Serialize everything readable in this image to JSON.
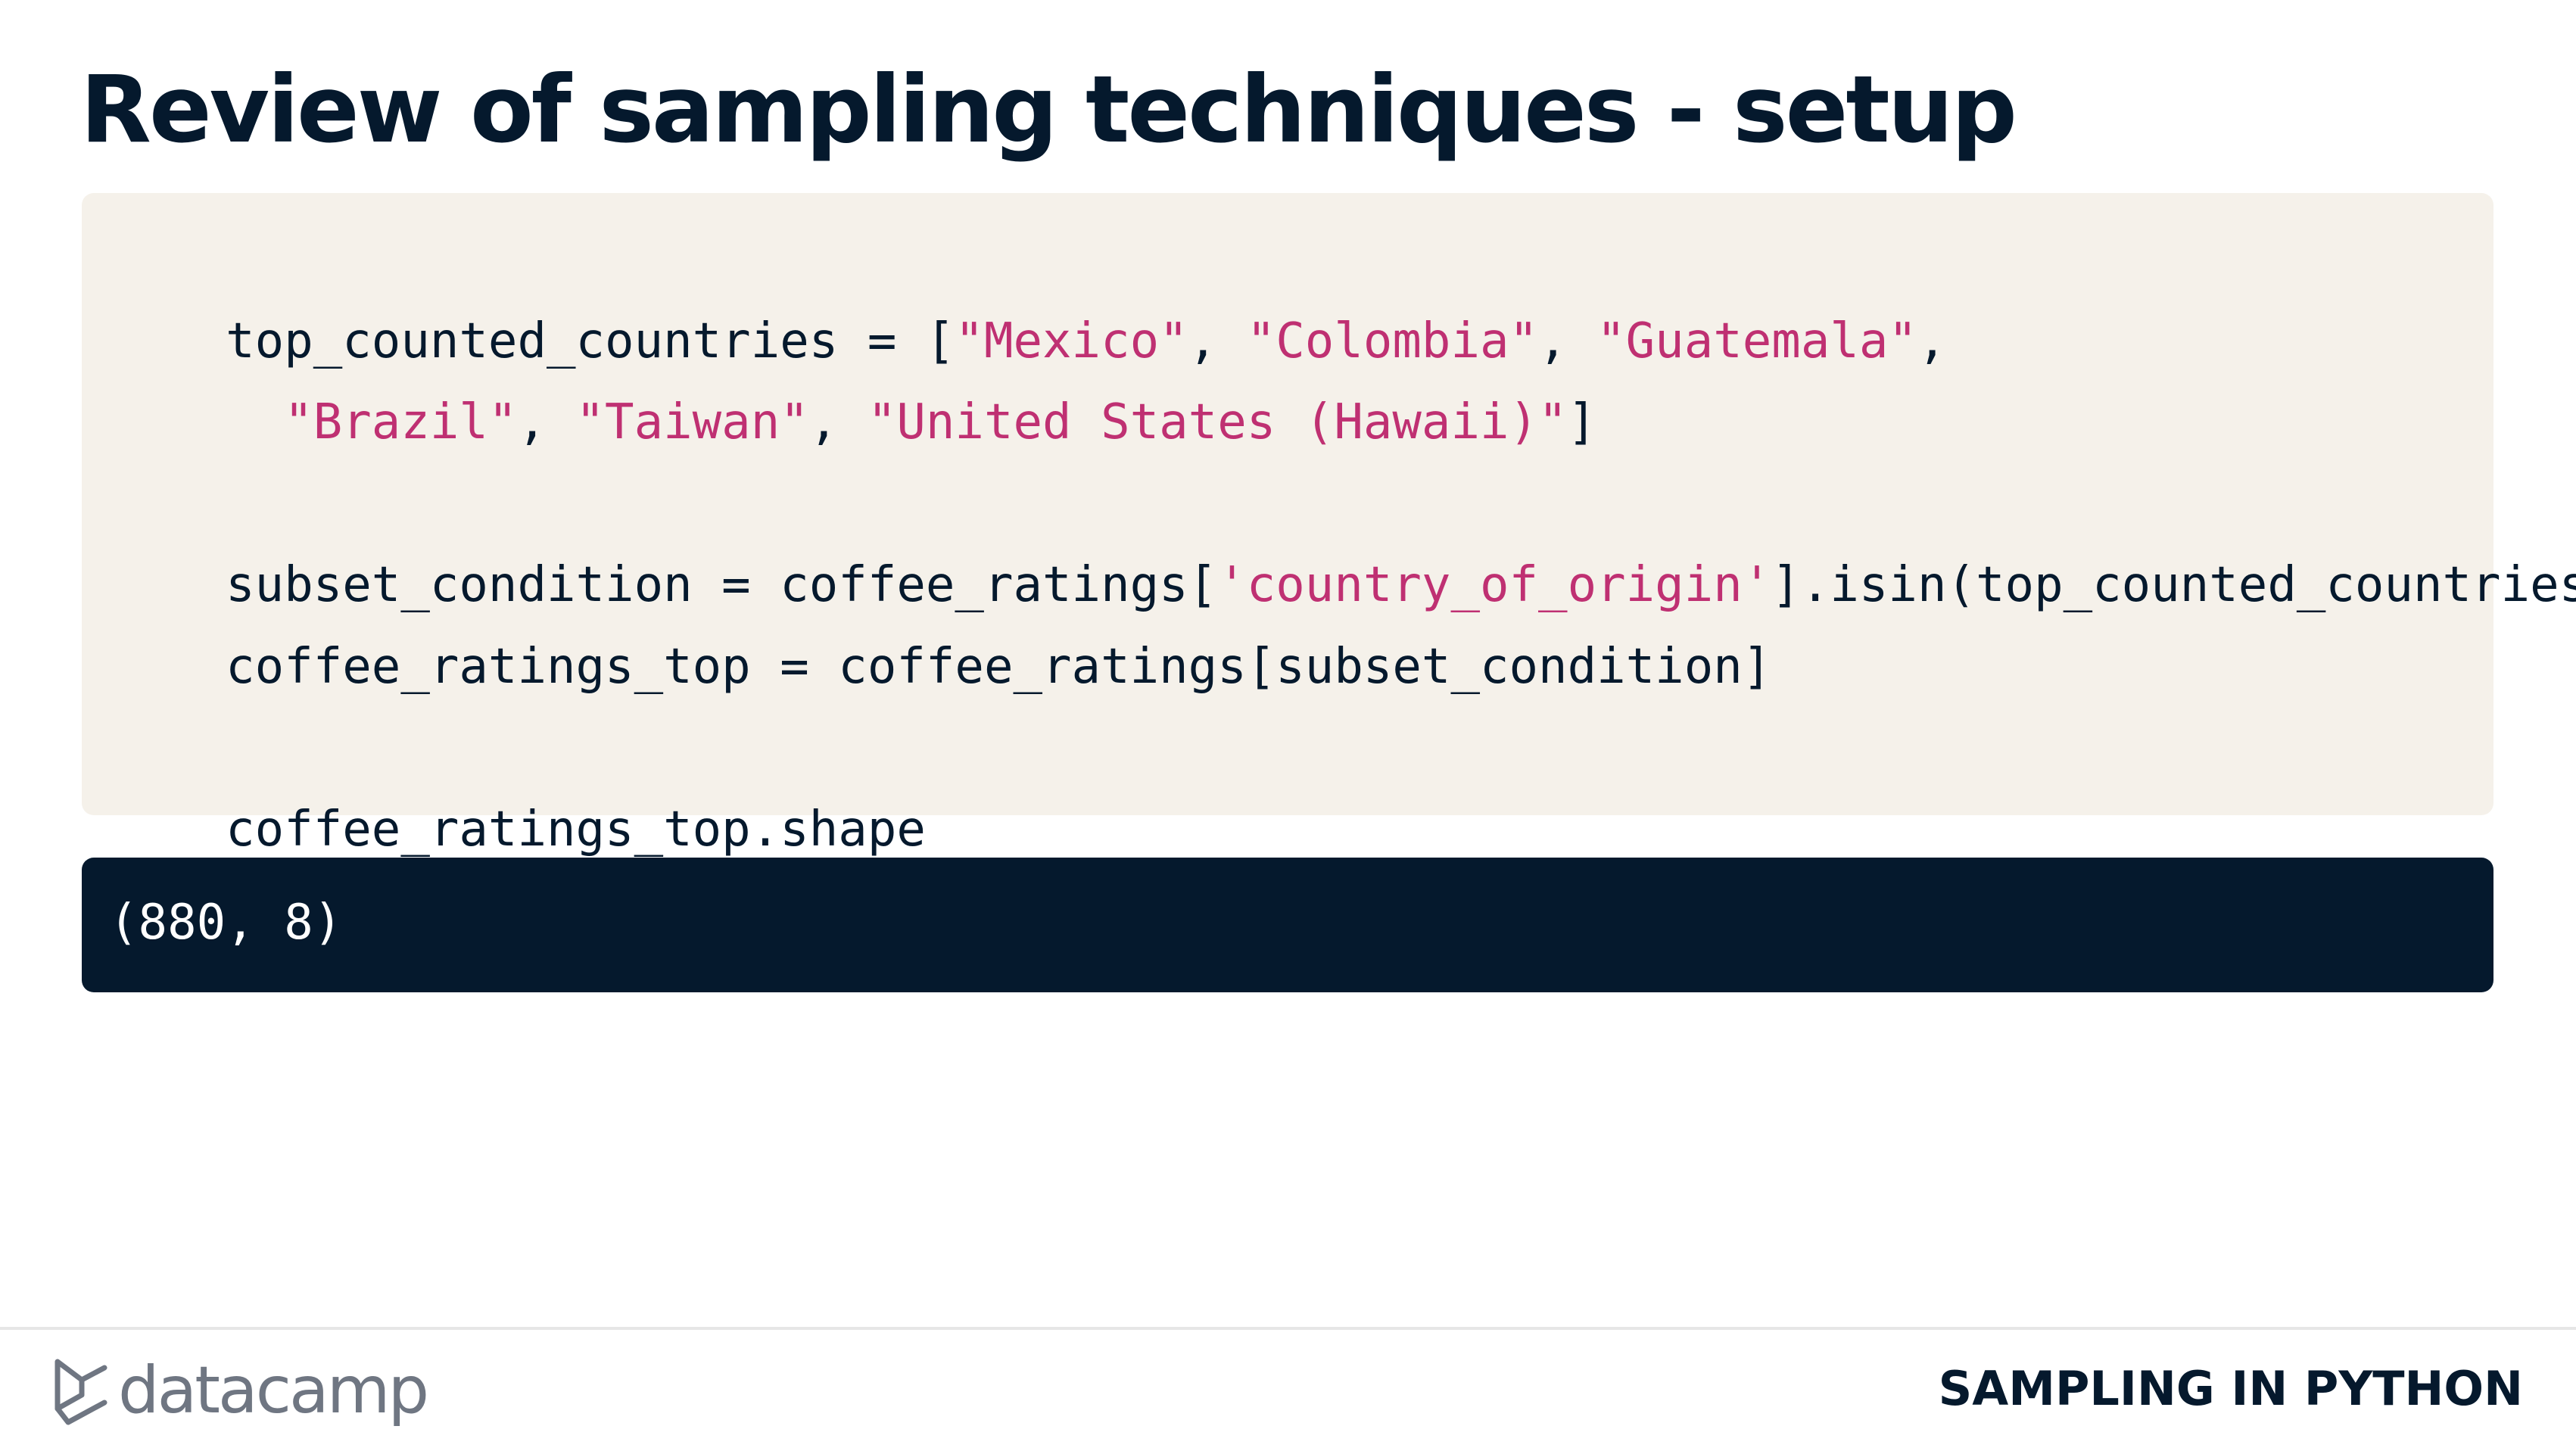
{
  "slide": {
    "title": "Review of sampling techniques - setup"
  },
  "code": {
    "lines": [
      [
        {
          "text": "top_counted_countries = [",
          "kind": "plain"
        },
        {
          "text": "\"Mexico\"",
          "kind": "string"
        },
        {
          "text": ", ",
          "kind": "plain"
        },
        {
          "text": "\"Colombia\"",
          "kind": "string"
        },
        {
          "text": ", ",
          "kind": "plain"
        },
        {
          "text": "\"Guatemala\"",
          "kind": "string"
        },
        {
          "text": ",",
          "kind": "plain"
        }
      ],
      [
        {
          "text": "  ",
          "kind": "plain"
        },
        {
          "text": "\"Brazil\"",
          "kind": "string"
        },
        {
          "text": ", ",
          "kind": "plain"
        },
        {
          "text": "\"Taiwan\"",
          "kind": "string"
        },
        {
          "text": ", ",
          "kind": "plain"
        },
        {
          "text": "\"United States (Hawaii)\"",
          "kind": "string"
        },
        {
          "text": "]",
          "kind": "plain"
        }
      ],
      [],
      [
        {
          "text": "subset_condition = coffee_ratings[",
          "kind": "plain"
        },
        {
          "text": "'country_of_origin'",
          "kind": "string"
        },
        {
          "text": "].isin(top_counted_countries)",
          "kind": "plain"
        }
      ],
      [
        {
          "text": "coffee_ratings_top = coffee_ratings[subset_condition]",
          "kind": "plain"
        }
      ],
      [],
      [
        {
          "text": "coffee_ratings_top.shape",
          "kind": "plain"
        }
      ]
    ]
  },
  "output": {
    "text": "(880, 8)"
  },
  "footer": {
    "brand": "datacamp",
    "logo_icon": "datacamp-logo-icon",
    "course": "SAMPLING IN PYTHON"
  },
  "colors": {
    "background": "#ffffff",
    "title": "#05192d",
    "code_background": "#f5f1ea",
    "string": "#bf3072",
    "output_background": "#05192d",
    "output_text": "#ffffff",
    "brand_gray": "#6f7682"
  }
}
